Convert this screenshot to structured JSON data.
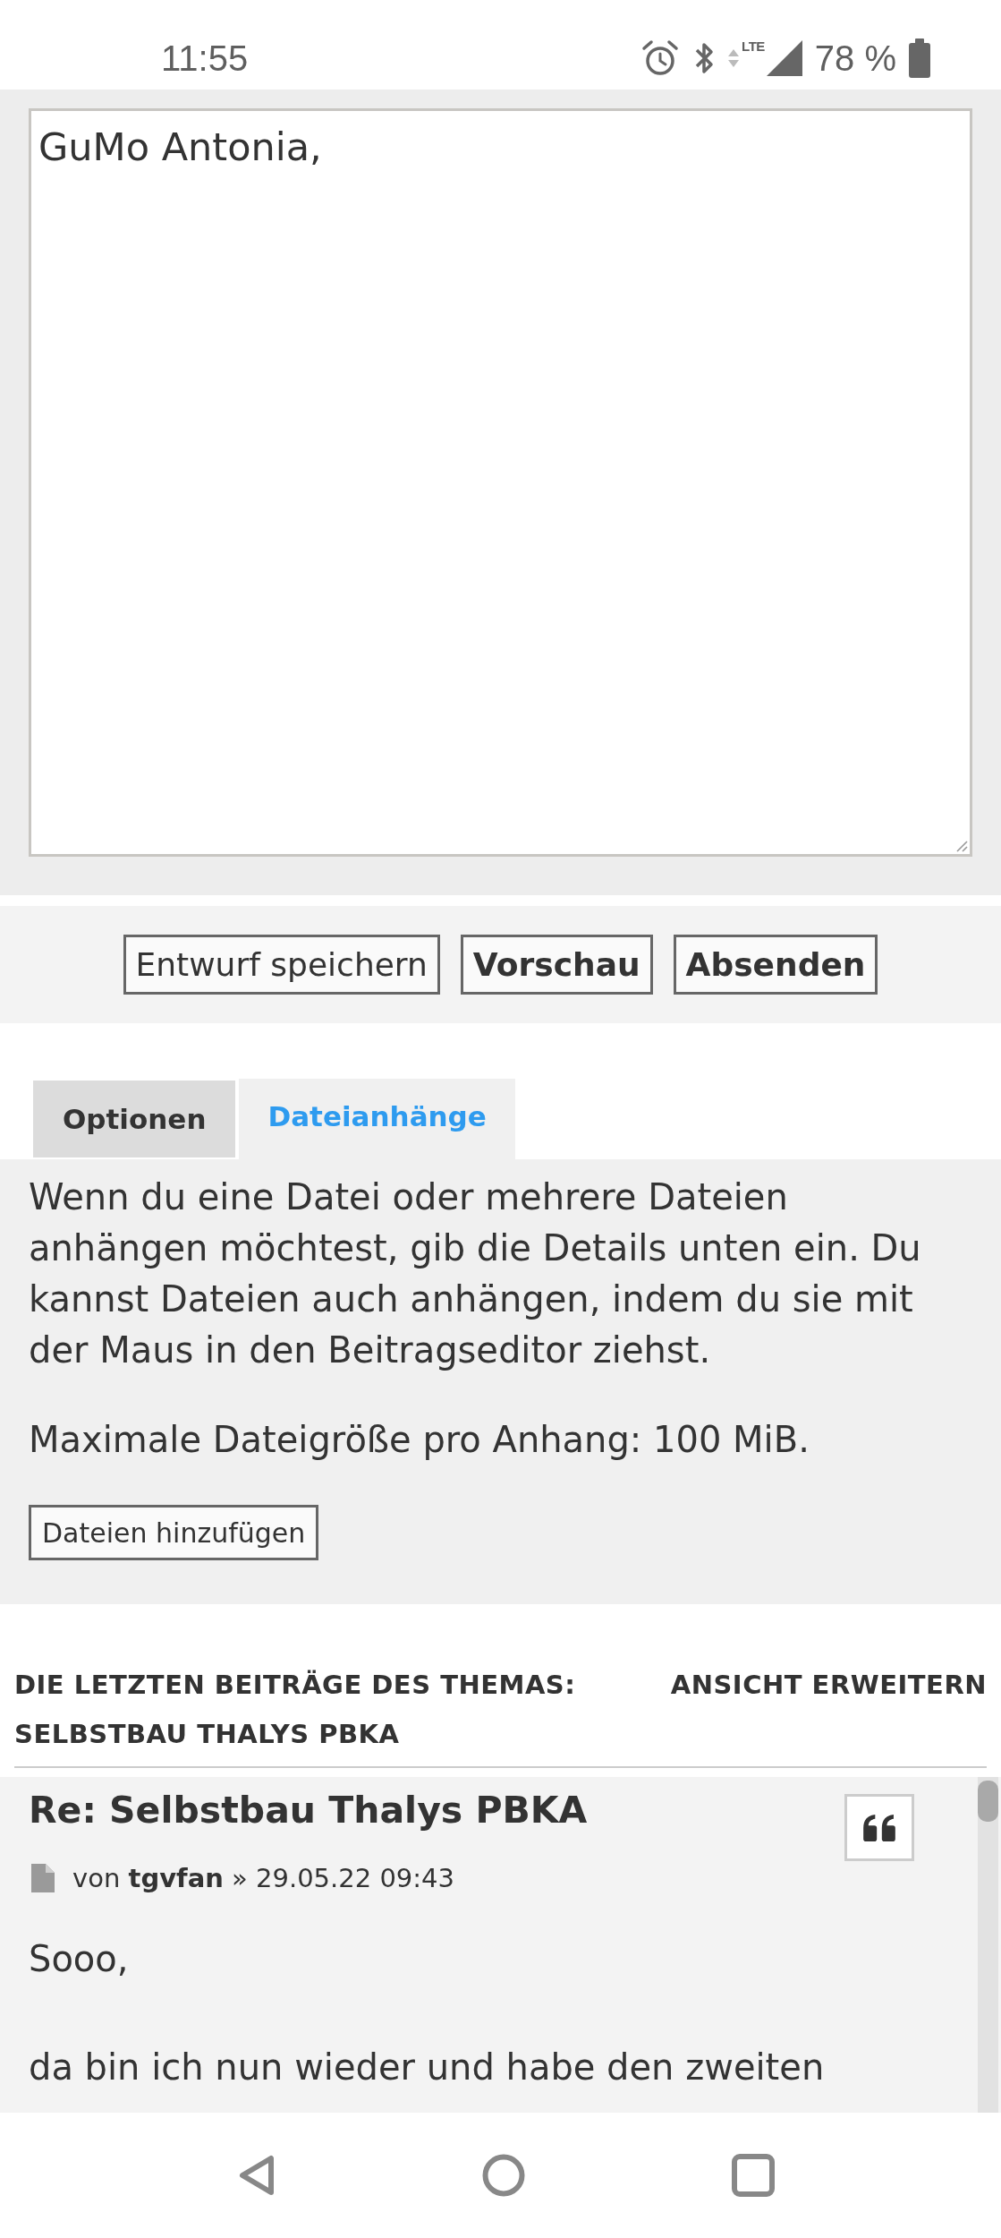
{
  "status_bar": {
    "time": "11:55",
    "network": "LTE",
    "battery": "78 %"
  },
  "editor": {
    "message": "GuMo Antonia,"
  },
  "actions": [
    {
      "label": "Entwurf speichern",
      "kind": "plain"
    },
    {
      "label": "Vorschau",
      "kind": "bold"
    },
    {
      "label": "Absenden",
      "kind": "bold"
    }
  ],
  "tabs": [
    {
      "label": "Optionen",
      "selected": false
    },
    {
      "label": "Dateianhänge",
      "selected": true
    }
  ],
  "attachments": {
    "description": "Wenn du eine Datei oder mehrere Dateien anhängen möchtest, gib die Details unten ein. Du kannst Dateien auch anhängen, indem du sie mit der Maus in den Beitragseditor ziehst.",
    "limit": "Maximale Dateigröße pro Anhang: 100 MiB.",
    "add_button": "Dateien hinzufügen"
  },
  "recent_posts": {
    "heading": "DIE LETZTEN BEITRÄGE DES THEMAS: SELBSTBAU THALYS PBKA",
    "expand_link": "ANSICHT ERWEITERN",
    "posts": [
      {
        "title": "Re: Selbstbau Thalys PBKA",
        "byline": {
          "prefix": "von",
          "author": "tgvfan",
          "suffix": "» 29.05.22 09:43"
        },
        "body": [
          "Sooo,",
          "da bin ich nun wieder und habe den zweiten"
        ]
      }
    ]
  }
}
